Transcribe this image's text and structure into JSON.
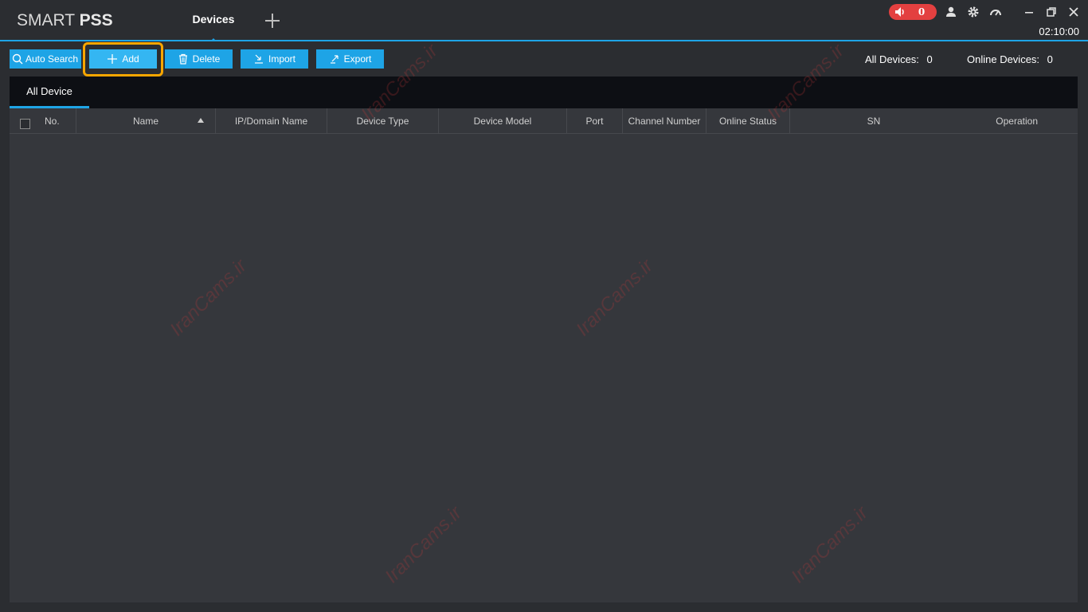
{
  "app": {
    "logo_light": "SMART",
    "logo_bold": "PSS",
    "active_tab": "Devices",
    "alarm_count": "0",
    "clock": "02:10:00"
  },
  "toolbar": {
    "auto_search": "Auto Search",
    "add": "Add",
    "delete": "Delete",
    "import": "Import",
    "export": "Export"
  },
  "stats": {
    "all_devices_label": "All Devices:",
    "all_devices_value": "0",
    "online_devices_label": "Online Devices:",
    "online_devices_value": "0"
  },
  "subtabs": {
    "all_device": "All Device"
  },
  "table": {
    "columns": {
      "no": "No.",
      "name": "Name",
      "ip": "IP/Domain Name",
      "device_type": "Device Type",
      "device_model": "Device Model",
      "port": "Port",
      "channel_number": "Channel Number",
      "online_status": "Online Status",
      "sn": "SN",
      "operation": "Operation"
    },
    "rows": []
  },
  "watermark": "IranCams.ir",
  "colors": {
    "accent": "#1ea4e6",
    "highlight": "#f7a600",
    "alarm": "#e34040"
  }
}
